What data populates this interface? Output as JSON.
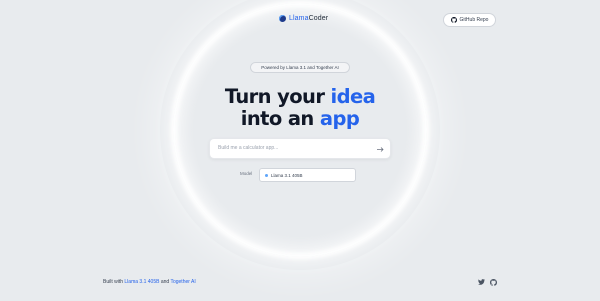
{
  "header": {
    "logo": {
      "name_part1": "Llama",
      "name_part2": "Coder"
    },
    "repo_button": {
      "label": "GitHub Repo",
      "icon": "github-icon"
    }
  },
  "hero": {
    "powered_by": "Powered by Llama 3.1 and Together AI",
    "headline_line1_start": "Turn your ",
    "headline_line1_accent": "idea",
    "headline_line2_start": "into an ",
    "headline_line2_accent": "app"
  },
  "prompt": {
    "placeholder": "Build me a calculator app...",
    "submit_icon": "arrow-right-icon"
  },
  "model": {
    "label": "Model",
    "selected": "Llama 3.1 405B"
  },
  "footer": {
    "built_with": "Built with ",
    "model_link": "Llama 3.1 405B",
    "and": " and ",
    "together_link": "Together AI",
    "social": [
      "twitter-icon",
      "github-icon"
    ]
  },
  "colors": {
    "accent": "#2563eb",
    "background": "#e8ebee",
    "text": "#111827"
  }
}
